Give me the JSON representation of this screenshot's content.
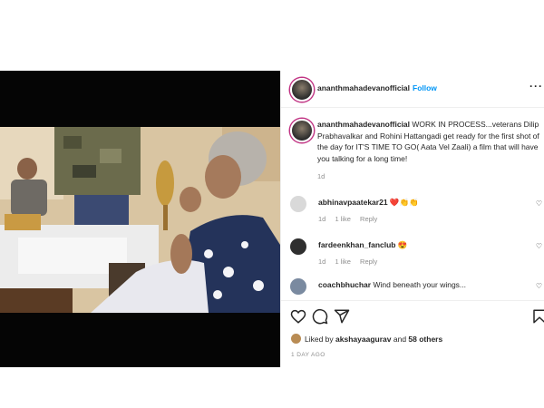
{
  "post": {
    "username": "ananthmahadevanofficial",
    "follow_label": "Follow",
    "more_label": "···",
    "caption_user": "ananthmahadevanofficial",
    "caption_text": "WORK IN PROCESS...veterans Dilip Prabhavalkar and Rohini Hattangadi get ready for the first shot of the day for IT'S TIME TO GO( Aata Vel Zaali) a film that will have you talking for a long time!",
    "caption_age": "1d"
  },
  "comments": [
    {
      "user": "abhinavpaatekar21",
      "text": "❤️👏👏",
      "age": "1d",
      "likes": "1 like",
      "reply": "Reply",
      "avatar_color": "#d9d9d9"
    },
    {
      "user": "fardeenkhan_fanclub",
      "text": "😍",
      "age": "1d",
      "likes": "1 like",
      "reply": "Reply",
      "avatar_color": "#2f2f2f"
    },
    {
      "user": "coachbhuchar",
      "text": "Wind beneath your wings...",
      "age": "",
      "likes": "",
      "reply": "",
      "avatar_color": "#7a8aa0"
    }
  ],
  "likes": {
    "prefix": "Liked by",
    "user": "akshayaagurav",
    "connector": "and",
    "others": "58 others"
  },
  "timestamp": "1 DAY AGO",
  "icons": {
    "like": "heart-icon",
    "comment": "comment-icon",
    "share": "share-icon",
    "save": "bookmark-icon",
    "more": "more-options-icon"
  },
  "colors": {
    "link": "#0095f6",
    "muted": "#8e8e8e",
    "text": "#262626"
  }
}
